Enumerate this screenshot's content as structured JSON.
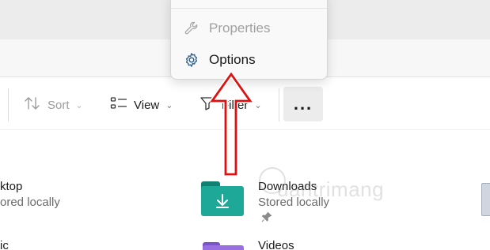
{
  "window": {
    "titlebar_color": "#ececec",
    "addressbar_color": "#f7f7f7"
  },
  "toolbar": {
    "sort_label": "Sort",
    "view_label": "View",
    "filter_label": "Filter",
    "more_label": "...",
    "icons": [
      "sort-icon",
      "view-icon",
      "filter-icon",
      "more-options-icon"
    ]
  },
  "context_menu": {
    "items": [
      {
        "label": "Properties",
        "icon": "wrench-icon",
        "enabled": false
      },
      {
        "label": "Options",
        "icon": "gear-icon",
        "enabled": true
      }
    ]
  },
  "quick_access": {
    "items": [
      {
        "name": "ktop",
        "status": "ored locally"
      },
      {
        "name": "Downloads",
        "status": "Stored locally",
        "pinned": true,
        "color": "#1ea897"
      },
      {
        "name": "ic"
      },
      {
        "name": "Videos",
        "color": "#9a6fe0"
      }
    ]
  },
  "annotation": {
    "arrow_color": "#e01010"
  },
  "watermark": {
    "text": "uantrimang"
  }
}
